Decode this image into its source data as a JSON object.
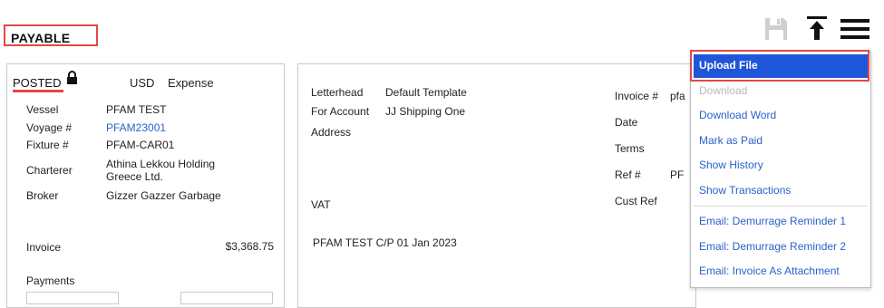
{
  "header": {
    "title": "PAYABLE"
  },
  "toolbar": {
    "save_icon": "save-icon",
    "upload_icon": "upload-icon",
    "menu_icon": "hamburger-menu-icon"
  },
  "summary": {
    "status": "POSTED",
    "currency": "USD",
    "type": "Expense",
    "vessel_label": "Vessel",
    "vessel_value": "PFAM TEST",
    "voyage_label": "Voyage #",
    "voyage_value": "PFAM23001",
    "fixture_label": "Fixture #",
    "fixture_value": "PFAM-CAR01",
    "charterer_label": "Charterer",
    "charterer_value_line1": "Athina Lekkou Holding",
    "charterer_value_line2": "Greece Ltd.",
    "broker_label": "Broker",
    "broker_value": "Gizzer Gazzer Garbage",
    "invoice_label": "Invoice",
    "invoice_value": "$3,368.75",
    "payments_label": "Payments"
  },
  "details": {
    "letterhead_label": "Letterhead",
    "letterhead_value": "Default Template",
    "account_label": "For Account",
    "account_value": "JJ Shipping One",
    "address_label": "Address",
    "vat_label": "VAT",
    "description": "PFAM TEST C/P 01 Jan 2023",
    "invoice_no_label": "Invoice #",
    "invoice_no_value": "pfa",
    "date_label": "Date",
    "terms_label": "Terms",
    "ref_label": "Ref #",
    "ref_value": "PF",
    "custref_label": "Cust Ref"
  },
  "menu": {
    "items": [
      {
        "label": "Upload File",
        "state": "active"
      },
      {
        "label": "Download",
        "state": "disabled"
      },
      {
        "label": "Download Word",
        "state": "normal"
      },
      {
        "label": "Mark as Paid",
        "state": "normal"
      },
      {
        "label": "Show History",
        "state": "normal"
      },
      {
        "label": "Show Transactions",
        "state": "normal"
      },
      {
        "label": "Email: Demurrage Reminder 1",
        "state": "normal"
      },
      {
        "label": "Email: Demurrage Reminder 2",
        "state": "normal"
      },
      {
        "label": "Email: Invoice As Attachment",
        "state": "normal"
      }
    ]
  },
  "colors": {
    "accent": "#1e56d9",
    "link": "#2a62c9",
    "highlight_frame": "#e04848"
  }
}
